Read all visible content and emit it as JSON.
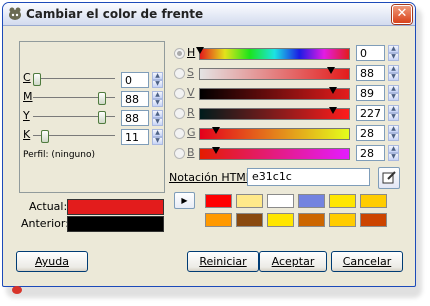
{
  "window": {
    "title": "Cambiar el color de frente",
    "close_glyph": "✕"
  },
  "cmyk": [
    {
      "letter": "C",
      "value": "0",
      "level": 0
    },
    {
      "letter": "M",
      "value": "88",
      "level": 88
    },
    {
      "letter": "Y",
      "value": "88",
      "level": 88
    },
    {
      "letter": "K",
      "value": "11",
      "level": 11
    }
  ],
  "profile": "Perfil: (ninguno)",
  "channels": [
    {
      "letter": "H",
      "value": "0",
      "level": 0,
      "selected": true,
      "gradient": "linear-gradient(to right,#e31c1c,#e3e31c,#1ce31c,#1ce3e3,#1c1ce3,#e31ce3,#e31c1c)"
    },
    {
      "letter": "S",
      "value": "88",
      "level": 88,
      "selected": false,
      "gradient": "linear-gradient(to right,#e3e3e3,#e31c1c)"
    },
    {
      "letter": "V",
      "value": "89",
      "level": 89,
      "selected": false,
      "gradient": "linear-gradient(to right,#000000,#e31c1c)"
    },
    {
      "letter": "R",
      "value": "227",
      "level": 227,
      "selected": false,
      "gradient": "linear-gradient(to right,#001c1c,#ff1c1c)"
    },
    {
      "letter": "G",
      "value": "28",
      "level": 28,
      "selected": false,
      "gradient": "linear-gradient(to right,#e3001c,#e3ff1c)"
    },
    {
      "letter": "B",
      "value": "28",
      "level": 28,
      "selected": false,
      "gradient": "linear-gradient(to right,#e31c00,#e31cff)"
    }
  ],
  "html_notation": {
    "label": "Notación HTML:",
    "value": "e31c1c"
  },
  "current": {
    "label": "Actual:",
    "color": "#e31c1c"
  },
  "previous": {
    "label": "Anterior:",
    "color": "#000000"
  },
  "history_colors": [
    "#ff0000",
    "#ffe98a",
    "#ffffff",
    "#7383e0",
    "#ffe600",
    "#ffcc00",
    "#ff9900",
    "#8a4a10",
    "#ffe600",
    "#cc6600",
    "#ffcc00",
    "#cc4400"
  ],
  "buttons": {
    "help": "Ayuda",
    "reset": "Reiniciar",
    "accept": "Aceptar",
    "cancel": "Cancelar"
  }
}
